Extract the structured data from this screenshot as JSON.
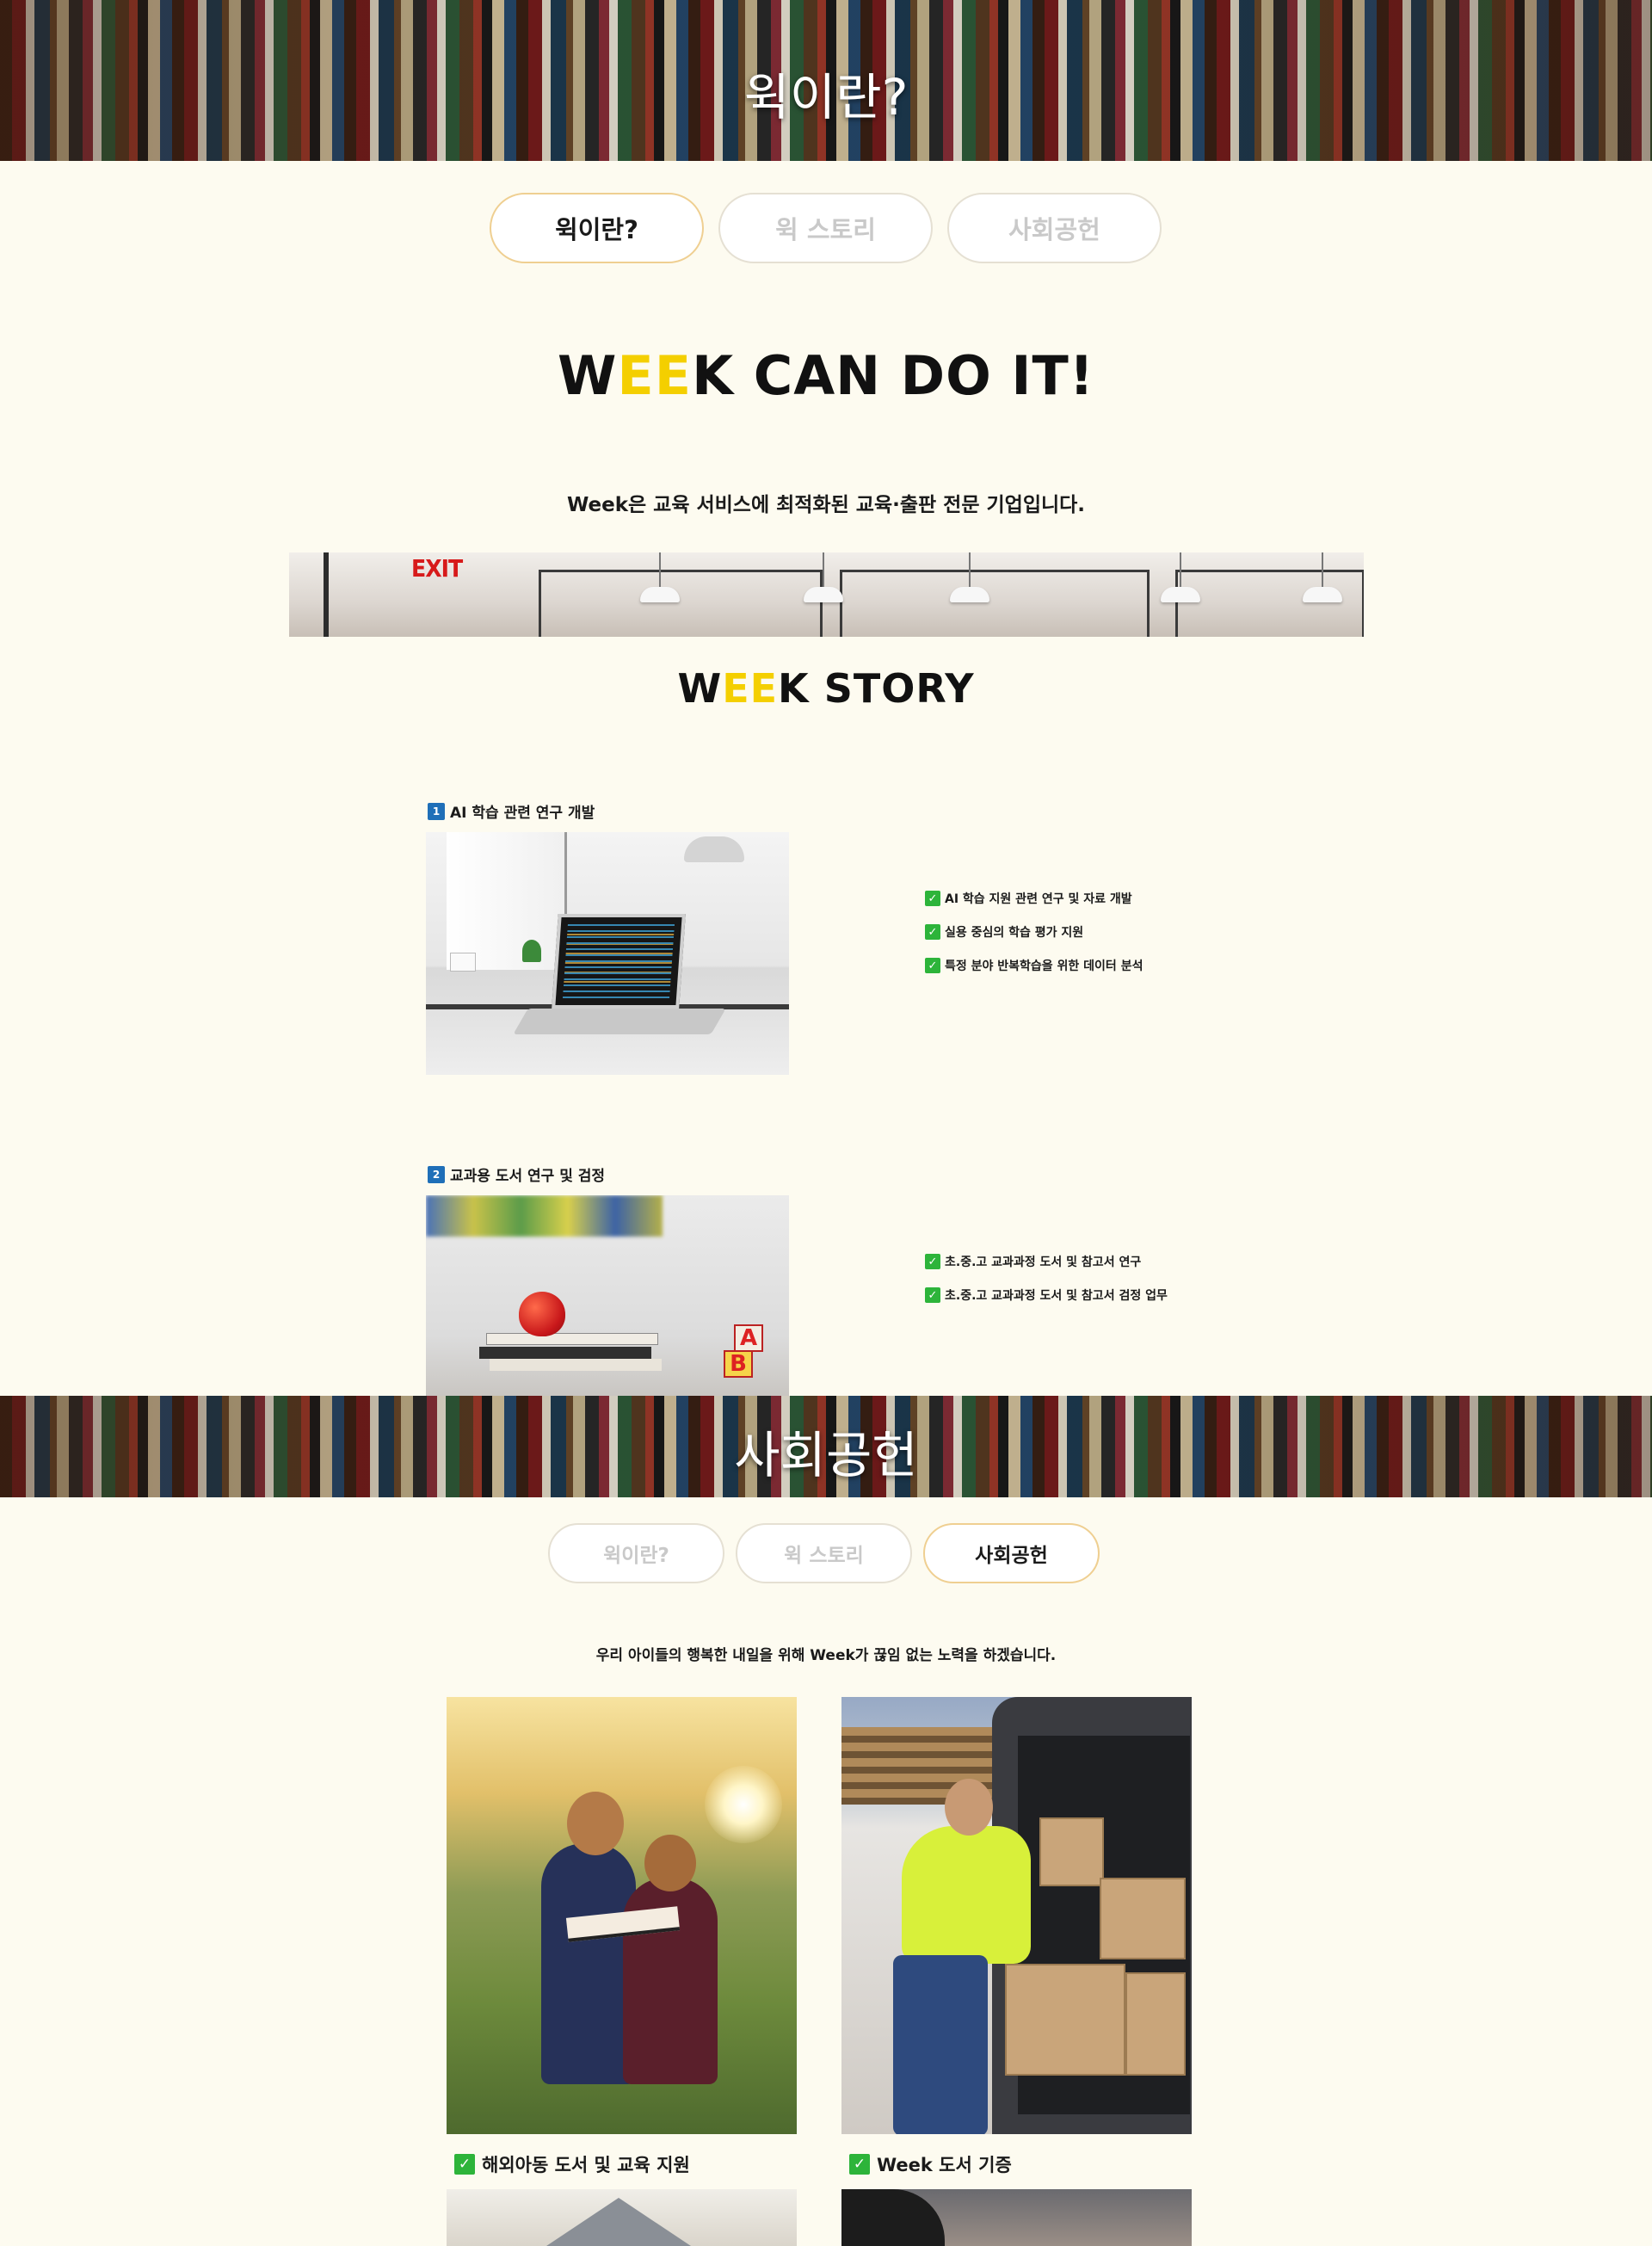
{
  "banner_top": {
    "title": "윅이란?"
  },
  "tabs_top": {
    "items": [
      {
        "label": "윅이란?",
        "active": true
      },
      {
        "label": "윅 스토리",
        "active": false
      },
      {
        "label": "사회공헌",
        "active": false
      }
    ]
  },
  "hero": {
    "brand_w": "W",
    "brand_ee": "EE",
    "brand_rest": "K CAN DO IT!",
    "subtitle": "Week은 교육 서비스에 최적화된 교육·출판 전문 기업입니다."
  },
  "office_photo": {
    "sign": "EXIT"
  },
  "story": {
    "brand_w": "W",
    "brand_ee": "EE",
    "brand_rest": "K STORY",
    "items": [
      {
        "num": "1",
        "title": "AI 학습 관련 연구 개발",
        "points": [
          "AI 학습 지원 관련 연구 및 자료 개발",
          "실용 중심의 학습 평가 지원",
          "특정 분야 반복학습을 위한 데이터 분석"
        ]
      },
      {
        "num": "2",
        "title": "교과용 도서 연구 및 검정",
        "points": [
          "초.중.고 교과과정 도서 및 참고서 연구",
          "초.중.고 교과과정 도서 및 참고서 검정 업무"
        ]
      }
    ]
  },
  "banner_social": {
    "title": "사회공헌"
  },
  "tabs_social": {
    "items": [
      {
        "label": "윅이란?",
        "active": false
      },
      {
        "label": "윅 스토리",
        "active": false
      },
      {
        "label": "사회공헌",
        "active": true
      }
    ]
  },
  "social": {
    "intro": "우리 아이들의 행복한 내일을 위해 Week가 끊임 없는 노력을 하겠습니다.",
    "items": [
      {
        "label": "해외아동 도서 및 교육 지원"
      },
      {
        "label": "Week 도서 기증"
      }
    ]
  },
  "icons": {
    "check": "check-icon",
    "number": "number-icon"
  },
  "colors": {
    "background": "#fdfbf0",
    "accent_yellow": "#f4cf00",
    "active_tab_border": "#efcf91",
    "check_green": "#2db43a",
    "number_blue": "#1f6fb8"
  }
}
